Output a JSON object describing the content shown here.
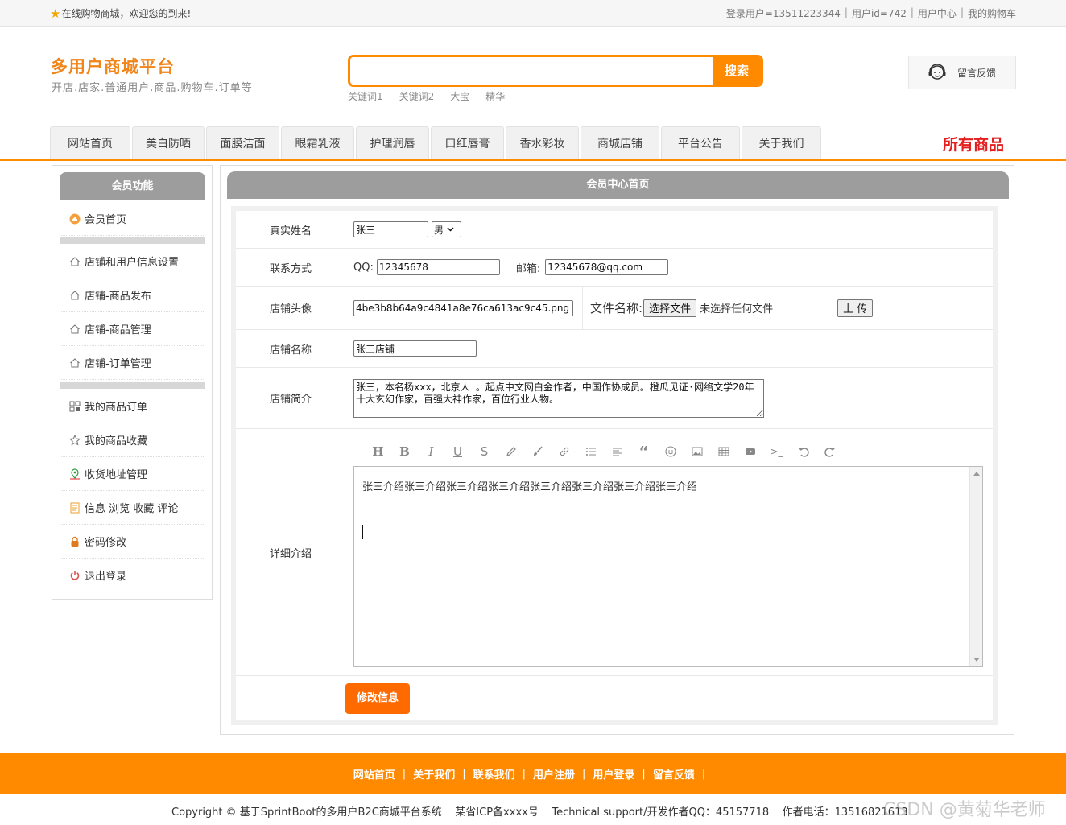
{
  "topbar": {
    "welcome": "在线购物商城，欢迎您的到来!",
    "user_login": "登录用户=13511223344",
    "user_id": "用户id=742",
    "user_center": "用户中心",
    "my_cart": "我的购物车"
  },
  "header": {
    "title": "多用户商城平台",
    "subtitle": "开店.店家.普通用户.商品.购物车.订单等",
    "search_button": "搜索",
    "search_value": "",
    "hotwords": [
      "关键词1",
      "关键词2",
      "大宝",
      "精华"
    ],
    "feedback": "留言反馈"
  },
  "nav": {
    "items": [
      "网站首页",
      "美白防晒",
      "面膜洁面",
      "眼霜乳液",
      "护理润唇",
      "口红唇膏",
      "香水彩妆",
      "商城店铺",
      "平台公告",
      "关于我们"
    ],
    "all_goods": "所有商品"
  },
  "sidebar": {
    "title": "会员功能",
    "home": "会员首页",
    "group1": [
      "店铺和用户信息设置",
      "店铺-商品发布",
      "店铺-商品管理",
      "店铺-订单管理"
    ],
    "group2": [
      "我的商品订单",
      "我的商品收藏",
      "收货地址管理",
      "信息 浏览 收藏 评论",
      "密码修改",
      "退出登录"
    ]
  },
  "main": {
    "title": "会员中心首页",
    "labels": {
      "real_name": "真实姓名",
      "contact": "联系方式",
      "avatar": "店铺头像",
      "shop_name": "店铺名称",
      "shop_intro": "店铺简介",
      "detail": "详细介绍"
    },
    "real_name": "张三",
    "gender": "男",
    "qq_label": "QQ:",
    "qq": "12345678",
    "email_label": "邮箱:",
    "email": "12345678@qq.com",
    "avatar_file": "4be3b8b64a9c4841a8e76ca613ac9c45.png",
    "file_name_label": "文件名称:",
    "choose_file": "选择文件",
    "no_file": "未选择任何文件",
    "upload": "上 传",
    "shop_name": "张三店铺",
    "shop_intro": "张三，本名杨xxx，北京人 。起点中文网白金作者，中国作协成员。橙瓜见证·网络文学20年十大玄幻作家，百强大神作家，百位行业人物。",
    "detail_content": "张三介绍张三介绍张三介绍张三介绍张三介绍张三介绍张三介绍张三介绍",
    "submit": "修改信息"
  },
  "footer": {
    "links": [
      "网站首页",
      "关于我们",
      "联系我们",
      "用户注册",
      "用户登录",
      "留言反馈"
    ],
    "copyright": "Copyright © 基于SprintBoot的多用户B2C商城平台系统    某省ICP备xxxx号    Technical support/开发作者QQ：45157718    作者电话：13516821613",
    "watermark": "CSDN @黄菊华老师"
  }
}
